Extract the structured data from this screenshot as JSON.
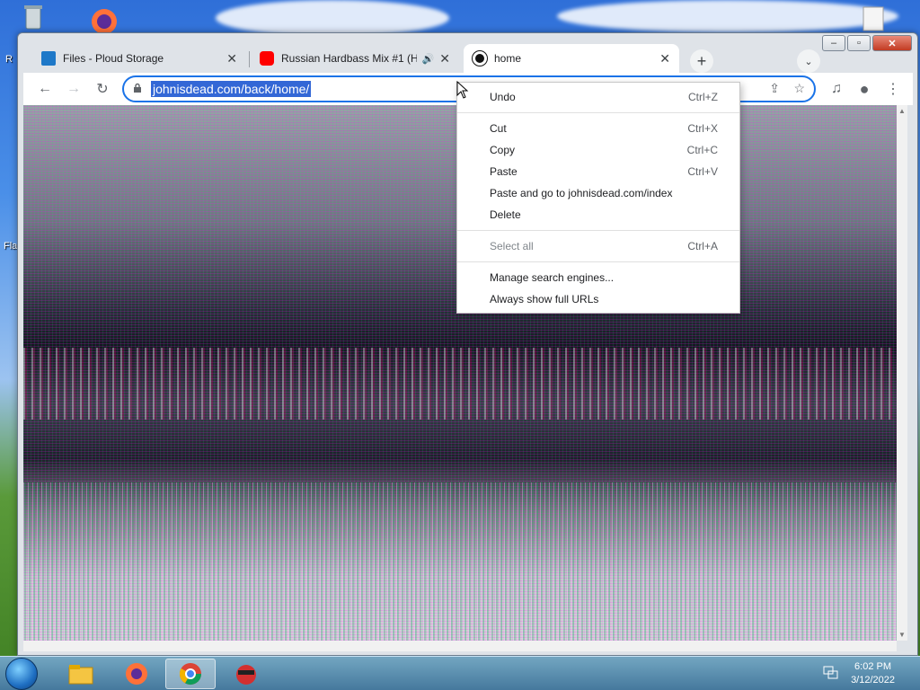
{
  "desktop": {
    "label_fragment_1": "R",
    "label_fragment_2": "Fla"
  },
  "window": {
    "minimize": "–",
    "maximize": "▫",
    "close": "✕"
  },
  "tabs": [
    {
      "title": "Files - Ploud Storage",
      "favicon_color": "#1e78c8",
      "close": "✕"
    },
    {
      "title": "Russian Hardbass Mix #1 (Ha",
      "favicon_color": "#ff0000",
      "close": "✕",
      "audio": "🔊"
    },
    {
      "title": "home",
      "favicon_color": "#111111",
      "close": "✕"
    }
  ],
  "toolbar": {
    "back": "←",
    "forward": "→",
    "reload": "↻",
    "url": "johnisdead.com/back/home/",
    "share": "⇪",
    "bookmark": "☆",
    "media": "♫",
    "profile": "●",
    "menu": "⋮"
  },
  "newtab": "+",
  "tabsearch": "⌄",
  "context_menu": {
    "items": [
      {
        "label": "Undo",
        "shortcut": "Ctrl+Z"
      },
      {
        "label": "Cut",
        "shortcut": "Ctrl+X"
      },
      {
        "label": "Copy",
        "shortcut": "Ctrl+C"
      },
      {
        "label": "Paste",
        "shortcut": "Ctrl+V"
      },
      {
        "label": "Paste and go to johnisdead.com/index",
        "shortcut": ""
      },
      {
        "label": "Delete",
        "shortcut": ""
      },
      {
        "label": "Select all",
        "shortcut": "Ctrl+A"
      },
      {
        "label": "Manage search engines...",
        "shortcut": ""
      },
      {
        "label": "Always show full URLs",
        "shortcut": ""
      }
    ]
  },
  "taskbar": {
    "time": "6:02 PM",
    "date": "3/12/2022"
  }
}
